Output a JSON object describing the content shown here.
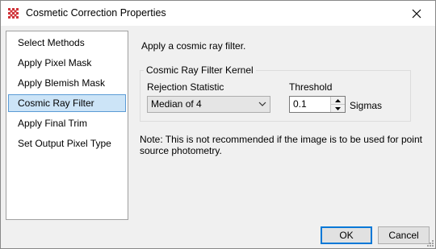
{
  "window": {
    "title": "Cosmetic Correction Properties",
    "close_icon": "close-icon",
    "app_icon": "app-grid-icon",
    "app_icon_color": "#d0343a"
  },
  "sidebar": {
    "items": [
      {
        "label": "Select Methods",
        "selected": false
      },
      {
        "label": "Apply Pixel Mask",
        "selected": false
      },
      {
        "label": "Apply Blemish Mask",
        "selected": false
      },
      {
        "label": "Cosmic Ray Filter",
        "selected": true
      },
      {
        "label": "Apply Final Trim",
        "selected": false
      },
      {
        "label": "Set Output Pixel Type",
        "selected": false
      }
    ],
    "selected_color": "#cce4f7"
  },
  "panel": {
    "intro": "Apply a cosmic ray filter.",
    "group_title": "Cosmic Ray Filter Kernel",
    "rejection_label": "Rejection Statistic",
    "rejection_value": "Median of 4",
    "threshold_label": "Threshold",
    "threshold_value": "0.1",
    "threshold_unit": "Sigmas",
    "note": "Note: This is not recommended if the image is to be used for point source photometry."
  },
  "buttons": {
    "ok": "OK",
    "cancel": "Cancel"
  }
}
